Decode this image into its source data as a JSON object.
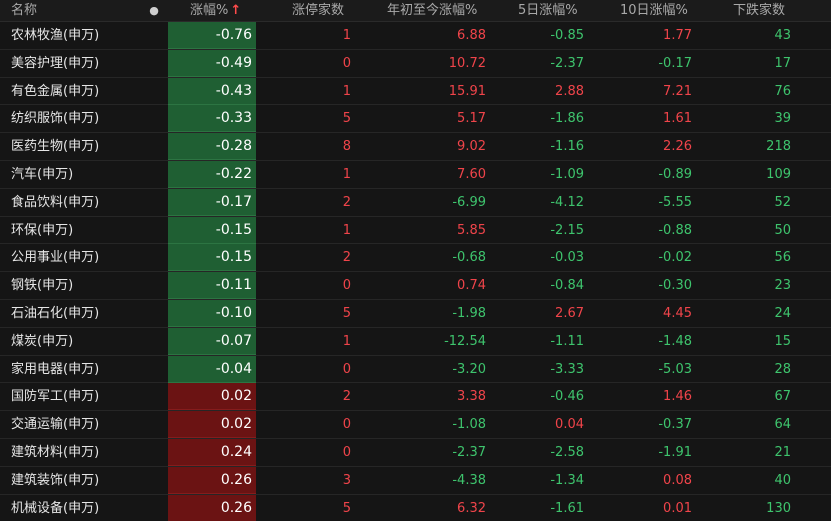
{
  "header": {
    "name": "名称",
    "dot": "●",
    "change_pct": "涨幅%",
    "sort_arrow": "↑",
    "limit_up_count": "涨停家数",
    "ytd_pct": "年初至今涨幅%",
    "d5_pct": "5日涨幅%",
    "d10_pct": "10日涨幅%",
    "down_count": "下跌家数"
  },
  "colors": {
    "up": "#f0444a",
    "down": "#3ec46d",
    "neg_cell_bg": "#1f5f33",
    "pos_cell_bg": "#6b1313"
  },
  "rows": [
    {
      "name": "农林牧渔(申万)",
      "chg": "-0.76",
      "limit": "1",
      "ytd": "6.88",
      "d5": "-0.85",
      "d10": "1.77",
      "down": "43"
    },
    {
      "name": "美容护理(申万)",
      "chg": "-0.49",
      "limit": "0",
      "ytd": "10.72",
      "d5": "-2.37",
      "d10": "-0.17",
      "down": "17"
    },
    {
      "name": "有色金属(申万)",
      "chg": "-0.43",
      "limit": "1",
      "ytd": "15.91",
      "d5": "2.88",
      "d10": "7.21",
      "down": "76"
    },
    {
      "name": "纺织服饰(申万)",
      "chg": "-0.33",
      "limit": "5",
      "ytd": "5.17",
      "d5": "-1.86",
      "d10": "1.61",
      "down": "39"
    },
    {
      "name": "医药生物(申万)",
      "chg": "-0.28",
      "limit": "8",
      "ytd": "9.02",
      "d5": "-1.16",
      "d10": "2.26",
      "down": "218"
    },
    {
      "name": "汽车(申万)",
      "chg": "-0.22",
      "limit": "1",
      "ytd": "7.60",
      "d5": "-1.09",
      "d10": "-0.89",
      "down": "109"
    },
    {
      "name": "食品饮料(申万)",
      "chg": "-0.17",
      "limit": "2",
      "ytd": "-6.99",
      "d5": "-4.12",
      "d10": "-5.55",
      "down": "52"
    },
    {
      "name": "环保(申万)",
      "chg": "-0.15",
      "limit": "1",
      "ytd": "5.85",
      "d5": "-2.15",
      "d10": "-0.88",
      "down": "50"
    },
    {
      "name": "公用事业(申万)",
      "chg": "-0.15",
      "limit": "2",
      "ytd": "-0.68",
      "d5": "-0.03",
      "d10": "-0.02",
      "down": "56"
    },
    {
      "name": "钢铁(申万)",
      "chg": "-0.11",
      "limit": "0",
      "ytd": "0.74",
      "d5": "-0.84",
      "d10": "-0.30",
      "down": "23"
    },
    {
      "name": "石油石化(申万)",
      "chg": "-0.10",
      "limit": "5",
      "ytd": "-1.98",
      "d5": "2.67",
      "d10": "4.45",
      "down": "24"
    },
    {
      "name": "煤炭(申万)",
      "chg": "-0.07",
      "limit": "1",
      "ytd": "-12.54",
      "d5": "-1.11",
      "d10": "-1.48",
      "down": "15"
    },
    {
      "name": "家用电器(申万)",
      "chg": "-0.04",
      "limit": "0",
      "ytd": "-3.20",
      "d5": "-3.33",
      "d10": "-5.03",
      "down": "28"
    },
    {
      "name": "国防军工(申万)",
      "chg": "0.02",
      "limit": "2",
      "ytd": "3.38",
      "d5": "-0.46",
      "d10": "1.46",
      "down": "67"
    },
    {
      "name": "交通运输(申万)",
      "chg": "0.02",
      "limit": "0",
      "ytd": "-1.08",
      "d5": "0.04",
      "d10": "-0.37",
      "down": "64"
    },
    {
      "name": "建筑材料(申万)",
      "chg": "0.24",
      "limit": "0",
      "ytd": "-2.37",
      "d5": "-2.58",
      "d10": "-1.91",
      "down": "21"
    },
    {
      "name": "建筑装饰(申万)",
      "chg": "0.26",
      "limit": "3",
      "ytd": "-4.38",
      "d5": "-1.34",
      "d10": "0.08",
      "down": "40"
    },
    {
      "name": "机械设备(申万)",
      "chg": "0.26",
      "limit": "5",
      "ytd": "6.32",
      "d5": "-1.61",
      "d10": "0.01",
      "down": "130"
    }
  ]
}
